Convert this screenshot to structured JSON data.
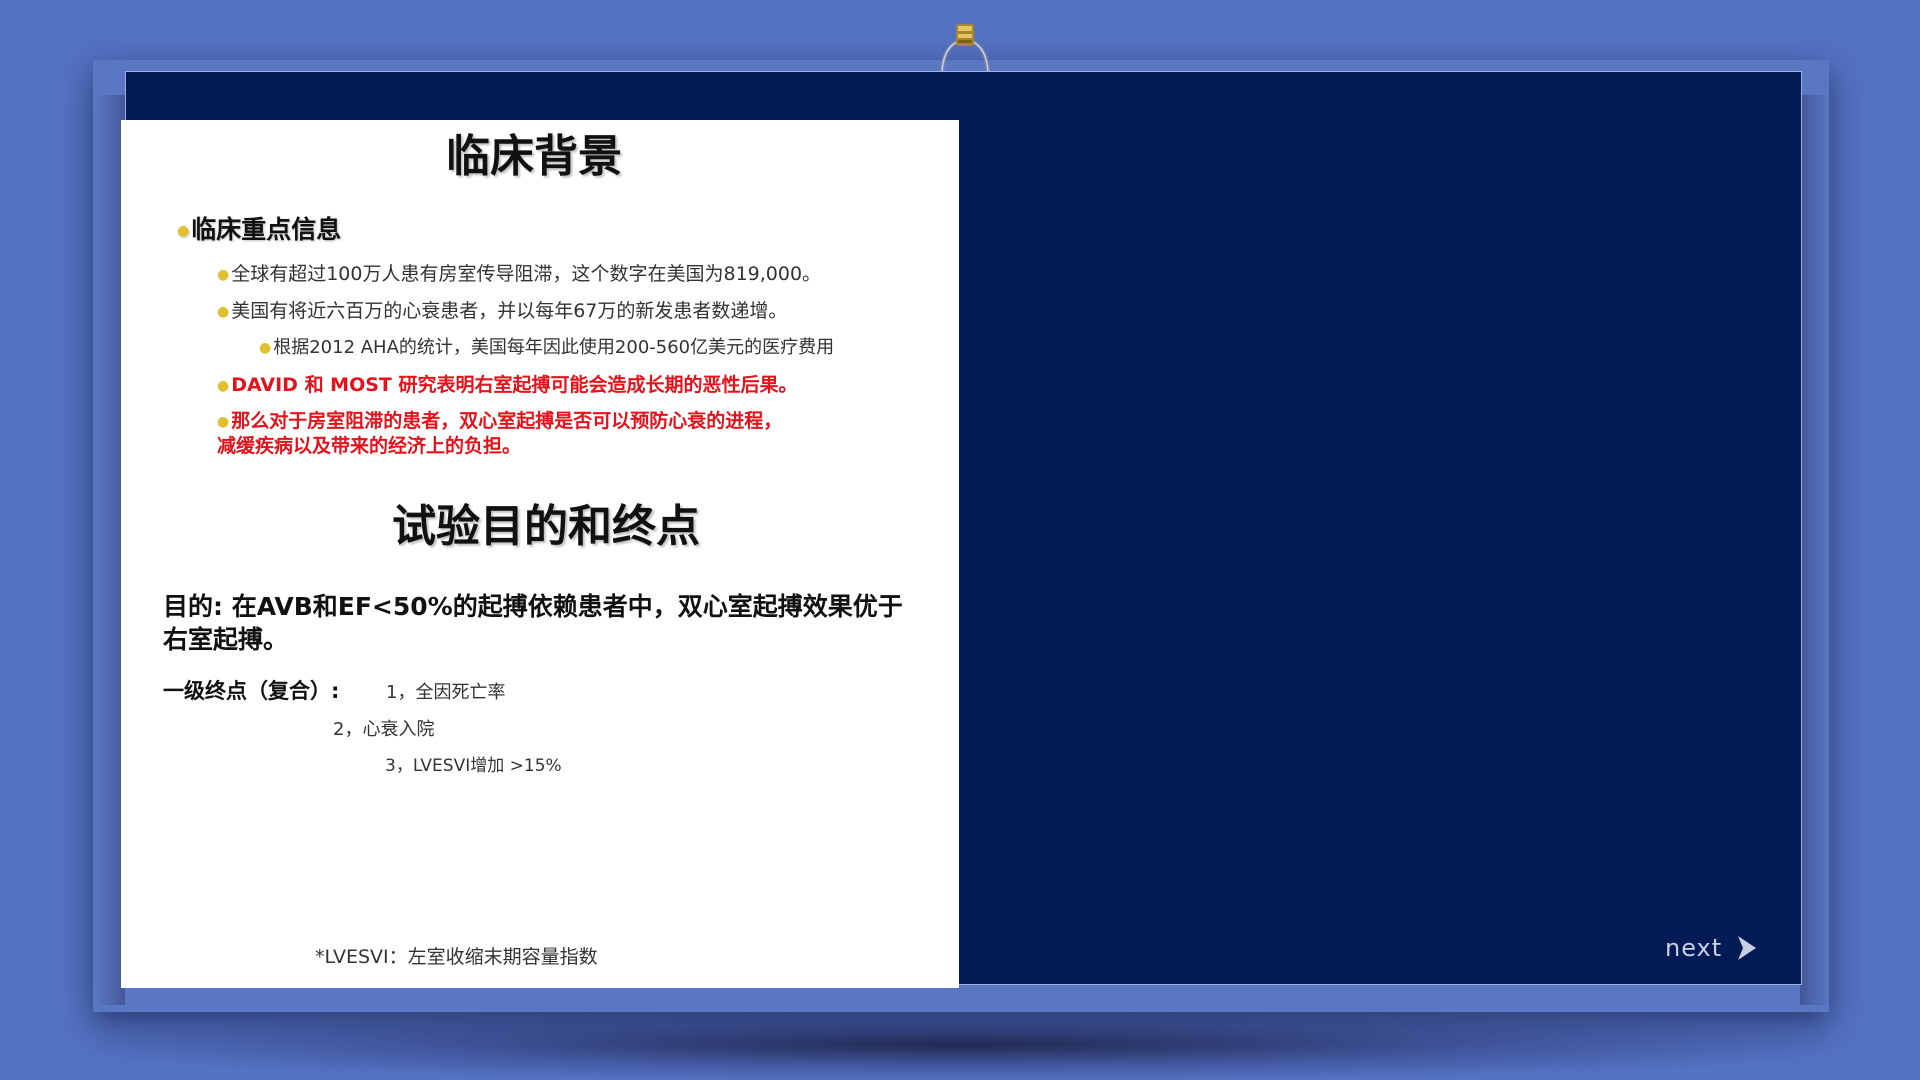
{
  "slide": {
    "title_background": "临床背景",
    "heading_clinical_info": "临床重点信息",
    "points": [
      "全球有超过100万人患有房室传导阻滞，这个数字在美国为819,000。",
      "美国有将近六百万的心衰患者，并以每年67万的新发患者数递增。",
      "根据2012 AHA的统计，美国每年因此使用200-560亿美元的医疗费用"
    ],
    "red_points": [
      "DAVID 和 MOST 研究表明右室起搏可能会造成长期的恶性后果。",
      "那么对于房室阻滞的患者，双心室起搏是否可以预防心衰的进程，",
      "减缓疾病以及带来的经济上的负担。"
    ],
    "title_objective": "试验目的和终点",
    "purpose": "目的: 在AVB和EF<50%的起搏依赖患者中，双心室起搏效果优于右室起搏。",
    "endpoint_label": "一级终点（复合）:",
    "endpoints": [
      "1，全因死亡率",
      "2，心衰入院",
      "3，LVESVI增加 >15%"
    ],
    "footnote": "*LVESVI：左室收缩末期容量指数"
  },
  "nav": {
    "next_label": "next",
    "next_icon": "chevron-right-icon"
  },
  "colors": {
    "background": "#5472c2",
    "frame": "#021b55",
    "slide": "#ffffff",
    "accent_red": "#e5121b",
    "bullet_yellow": "#e0c030"
  }
}
